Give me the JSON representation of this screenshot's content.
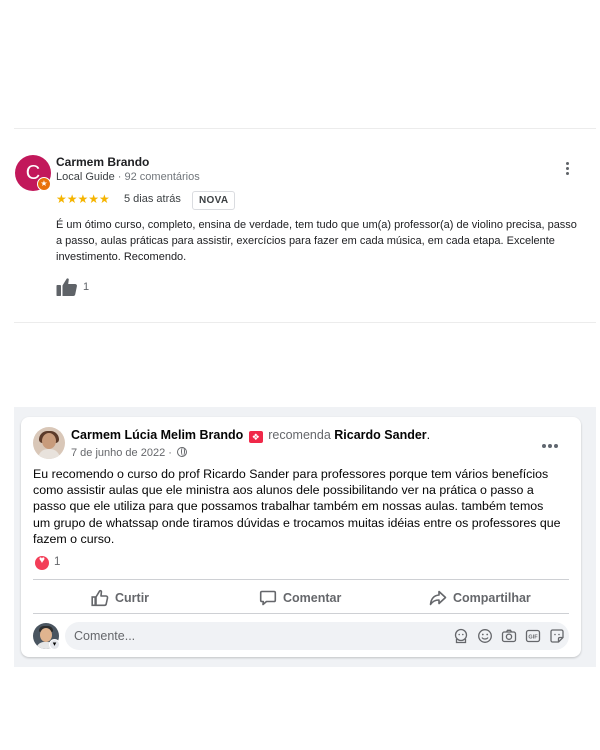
{
  "google_review": {
    "avatar_letter": "C",
    "avatar_color": "#c2185b",
    "badge_color": "#e8710a",
    "author": "Carmem Brando",
    "role": "Local Guide",
    "separator": "·",
    "reviews_count": "92 comentários",
    "rating": 5,
    "stars": "★★★★★",
    "star_color": "#f5b400",
    "time_ago": "5 dias atrás",
    "new_badge": "NOVA",
    "text": "É um ótimo curso, completo, ensina de verdade, tem tudo que um(a) professor(a) de violino precisa, passo a passo, aulas práticas para assistir, exercícios para fazer em cada música, em cada etapa. Excelente investimento. Recomendo.",
    "likes": "1",
    "icons": {
      "more": "more-vert-icon",
      "like": "thumbs-up-icon",
      "badge": "local-guide-star-icon"
    }
  },
  "facebook_post": {
    "author": "Carmem Lúcia Melim Brando",
    "verb": "recomenda",
    "target": "Ricardo Sander",
    "period": ".",
    "date": "7 de junho de 2022",
    "date_separator": "·",
    "body": "Eu recomendo o curso do prof Ricardo Sander para professores porque tem vários benefícios como assistir aulas que ele ministra aos alunos dele possibilitando ver na prática o passo a passo que ele utiliza para que possamos trabalhar também em nossas aulas. também temos um grupo de whatssap onde tiramos dúvidas e trocamos muitas idéias entre os professores que fazem o curso.",
    "reactions": {
      "count": "1",
      "type": "love",
      "color": "#f33e58"
    },
    "actions": {
      "like": "Curtir",
      "comment": "Comentar",
      "share": "Compartilhar"
    },
    "comment_placeholder": "Comente...",
    "icons": {
      "recommend": "recommend-icon",
      "privacy": "globe-icon",
      "more": "more-horiz-icon",
      "comment_tools": [
        "avatar-sticker-icon",
        "emoji-icon",
        "camera-icon",
        "gif-icon",
        "sticker-icon"
      ]
    },
    "accent_color": "#f02849"
  }
}
